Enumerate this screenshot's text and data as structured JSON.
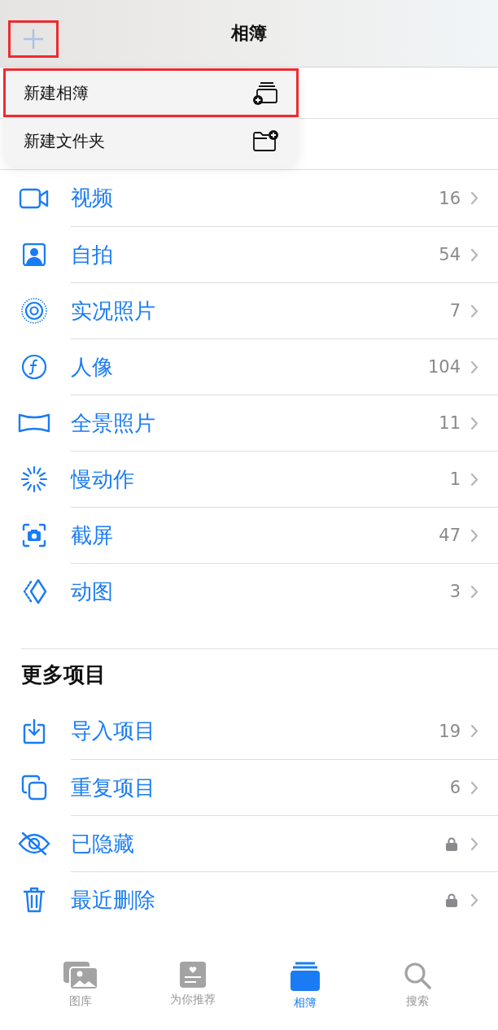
{
  "nav": {
    "title": "相簿",
    "add_button": {
      "highlighted": true
    }
  },
  "menu": [
    {
      "label": "新建相簿",
      "kind": "album",
      "highlighted": true
    },
    {
      "label": "新建文件夹",
      "kind": "folder",
      "highlighted": false
    }
  ],
  "media_types": [
    {
      "label": "视频",
      "kind": "video",
      "count": "16"
    },
    {
      "label": "自拍",
      "kind": "selfie",
      "count": "54"
    },
    {
      "label": "实况照片",
      "kind": "live",
      "count": "7"
    },
    {
      "label": "人像",
      "kind": "portrait",
      "count": "104"
    },
    {
      "label": "全景照片",
      "kind": "panorama",
      "count": "11"
    },
    {
      "label": "慢动作",
      "kind": "slowmo",
      "count": "1"
    },
    {
      "label": "截屏",
      "kind": "screenshot",
      "count": "47"
    },
    {
      "label": "动图",
      "kind": "animated",
      "count": "3"
    }
  ],
  "more": {
    "title": "更多项目",
    "items": [
      {
        "label": "导入项目",
        "kind": "import",
        "locked": false,
        "count": "19"
      },
      {
        "label": "重复项目",
        "kind": "duplicate",
        "locked": false,
        "count": "6"
      },
      {
        "label": "已隐藏",
        "kind": "hidden",
        "locked": true
      },
      {
        "label": "最近删除",
        "kind": "trash",
        "locked": true
      }
    ]
  },
  "tabs": [
    {
      "label": "图库",
      "kind": "library",
      "selected": false
    },
    {
      "label": "为你推荐",
      "kind": "foryou",
      "selected": false
    },
    {
      "label": "相簿",
      "kind": "albums",
      "selected": true
    },
    {
      "label": "搜索",
      "kind": "search",
      "selected": false
    }
  ]
}
